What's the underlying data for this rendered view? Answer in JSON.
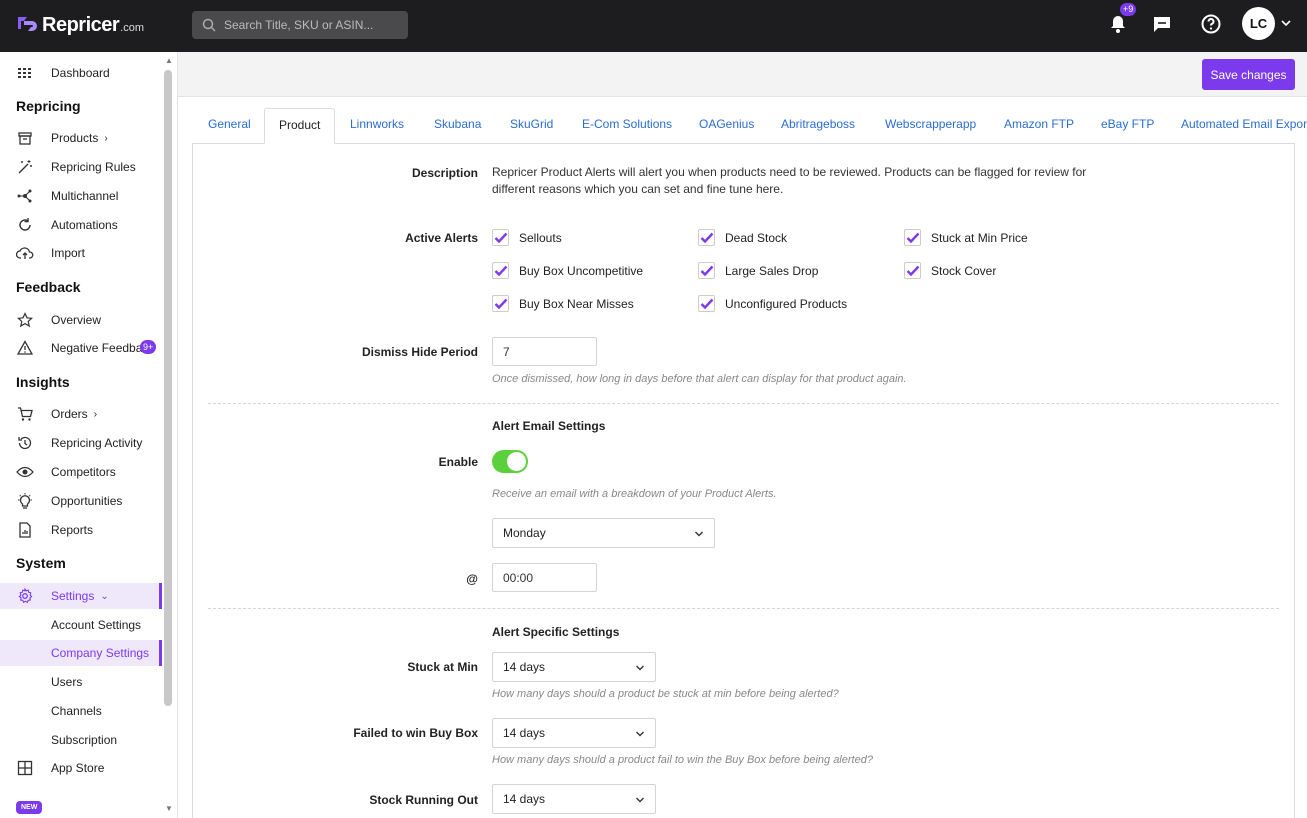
{
  "brand": {
    "name": "Repricer",
    "suffix": ".com"
  },
  "search": {
    "placeholder": "Search Title, SKU or ASIN..."
  },
  "topbar": {
    "notifications_badge": "+9",
    "avatar_initials": "LC"
  },
  "sidebar": {
    "dashboard": "Dashboard",
    "sections": {
      "repricing": "Repricing",
      "feedback": "Feedback",
      "insights": "Insights",
      "system": "System"
    },
    "items": {
      "products": "Products",
      "repricing_rules": "Repricing Rules",
      "multichannel": "Multichannel",
      "automations": "Automations",
      "import": "Import",
      "overview": "Overview",
      "negative_feedback": "Negative Feedback",
      "negative_feedback_badge": "9+",
      "orders": "Orders",
      "repricing_activity": "Repricing Activity",
      "competitors": "Competitors",
      "opportunities": "Opportunities",
      "reports": "Reports",
      "settings": "Settings",
      "account_settings": "Account Settings",
      "company_settings": "Company Settings",
      "users": "Users",
      "channels": "Channels",
      "subscription": "Subscription",
      "app_store": "App Store",
      "new_badge": "NEW"
    }
  },
  "toolbar": {
    "save_label": "Save changes"
  },
  "tabs": [
    "General",
    "Product",
    "Linnworks",
    "Skubana",
    "SkuGrid",
    "E-Com Solutions",
    "OAGenius",
    "Abritrageboss",
    "Webscrapperapp",
    "Amazon FTP",
    "eBay FTP",
    "Automated Email Export"
  ],
  "form": {
    "description_label": "Description",
    "description_text": "Repricer Product Alerts will alert you when products need to be reviewed. Products can be flagged for review for different reasons which you can set and fine tune here.",
    "active_alerts_label": "Active Alerts",
    "alerts": [
      "Sellouts",
      "Dead Stock",
      "Stuck at Min Price",
      "Buy Box Uncompetitive",
      "Large Sales Drop",
      "Stock Cover",
      "Buy Box Near Misses",
      "Unconfigured Products"
    ],
    "dismiss_label": "Dismiss Hide Period",
    "dismiss_value": "7",
    "dismiss_hint": "Once dismissed, how long in days before that alert can display for that product again.",
    "email_section_title": "Alert Email Settings",
    "enable_label": "Enable",
    "enable_state": true,
    "enable_hint": "Receive an email with a breakdown of your Product Alerts.",
    "day_value": "Monday",
    "at_label": "@",
    "time_value": "00:00",
    "specific_section_title": "Alert Specific Settings",
    "stuck_label": "Stuck at Min",
    "stuck_value": "14 days",
    "stuck_hint": "How many days should a product be stuck at min before being alerted?",
    "failed_label": "Failed to win Buy Box",
    "failed_value": "14 days",
    "failed_hint": "How many days should a product fail to win the Buy Box before being alerted?",
    "stock_label": "Stock Running Out",
    "stock_value": "14 days"
  },
  "colors": {
    "accent": "#7c3aed",
    "topbar": "#1d1d1f",
    "toggle_on": "#5cd03a",
    "link": "#2b6cd1"
  }
}
